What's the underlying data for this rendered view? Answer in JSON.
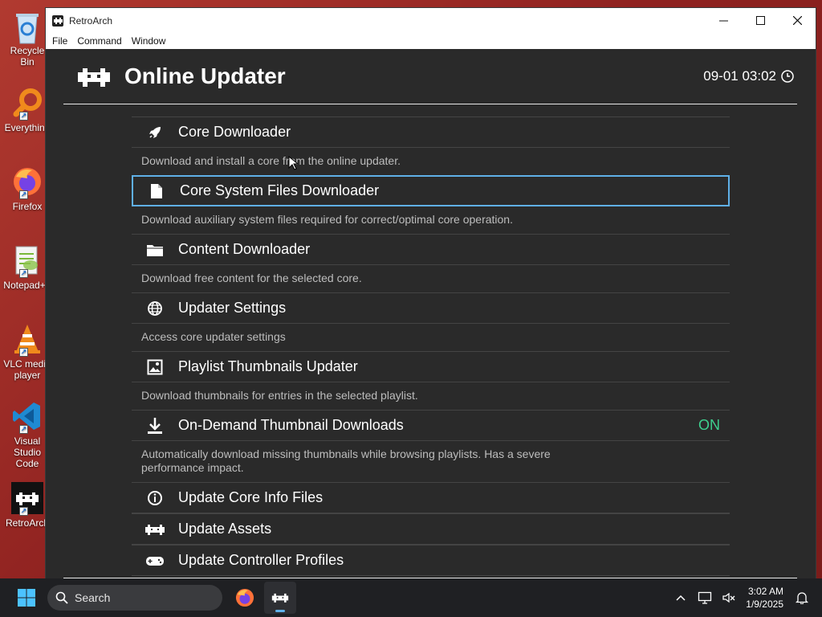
{
  "desktop": {
    "icons": [
      {
        "label": "Recycle Bin"
      },
      {
        "label": "Everything"
      },
      {
        "label": "Firefox"
      },
      {
        "label": "Notepad++"
      },
      {
        "label": "VLC media player"
      },
      {
        "label": "Visual Studio Code"
      },
      {
        "label": "RetroArch"
      }
    ]
  },
  "window": {
    "title": "RetroArch",
    "controls": {
      "minimize": "—",
      "maximize": "☐",
      "close": "✕"
    },
    "menus": [
      "File",
      "Command",
      "Window"
    ]
  },
  "retroarch": {
    "header_title": "Online Updater",
    "clock": "09-01 03:02",
    "items": [
      {
        "icon": "rocket-icon",
        "label": "Core Downloader",
        "sublabel": "Download and install a core from the online updater."
      },
      {
        "icon": "file-icon",
        "label": "Core System Files Downloader",
        "sublabel": "Download auxiliary system files required for correct/optimal core operation.",
        "selected": true
      },
      {
        "icon": "folder-icon",
        "label": "Content Downloader",
        "sublabel": "Download free content for the selected core."
      },
      {
        "icon": "globe-icon",
        "label": "Updater Settings",
        "sublabel": "Access core updater settings"
      },
      {
        "icon": "image-icon",
        "label": "Playlist Thumbnails Updater",
        "sublabel": "Download thumbnails for entries in the selected playlist."
      },
      {
        "icon": "download-icon",
        "label": "On-Demand Thumbnail Downloads",
        "value": "ON",
        "sublabel": "Automatically download missing thumbnails while browsing playlists. Has a severe performance impact."
      },
      {
        "icon": "info-icon",
        "label": "Update Core Info Files"
      },
      {
        "icon": "retroarch-icon",
        "label": "Update Assets"
      },
      {
        "icon": "gamepad-icon",
        "label": "Update Controller Profiles"
      }
    ],
    "accent_selected": "#5fb0e8",
    "value_on_color": "#3ecf8e"
  },
  "taskbar": {
    "search_placeholder": "Search",
    "time": "3:02 AM",
    "date": "1/9/2025"
  }
}
